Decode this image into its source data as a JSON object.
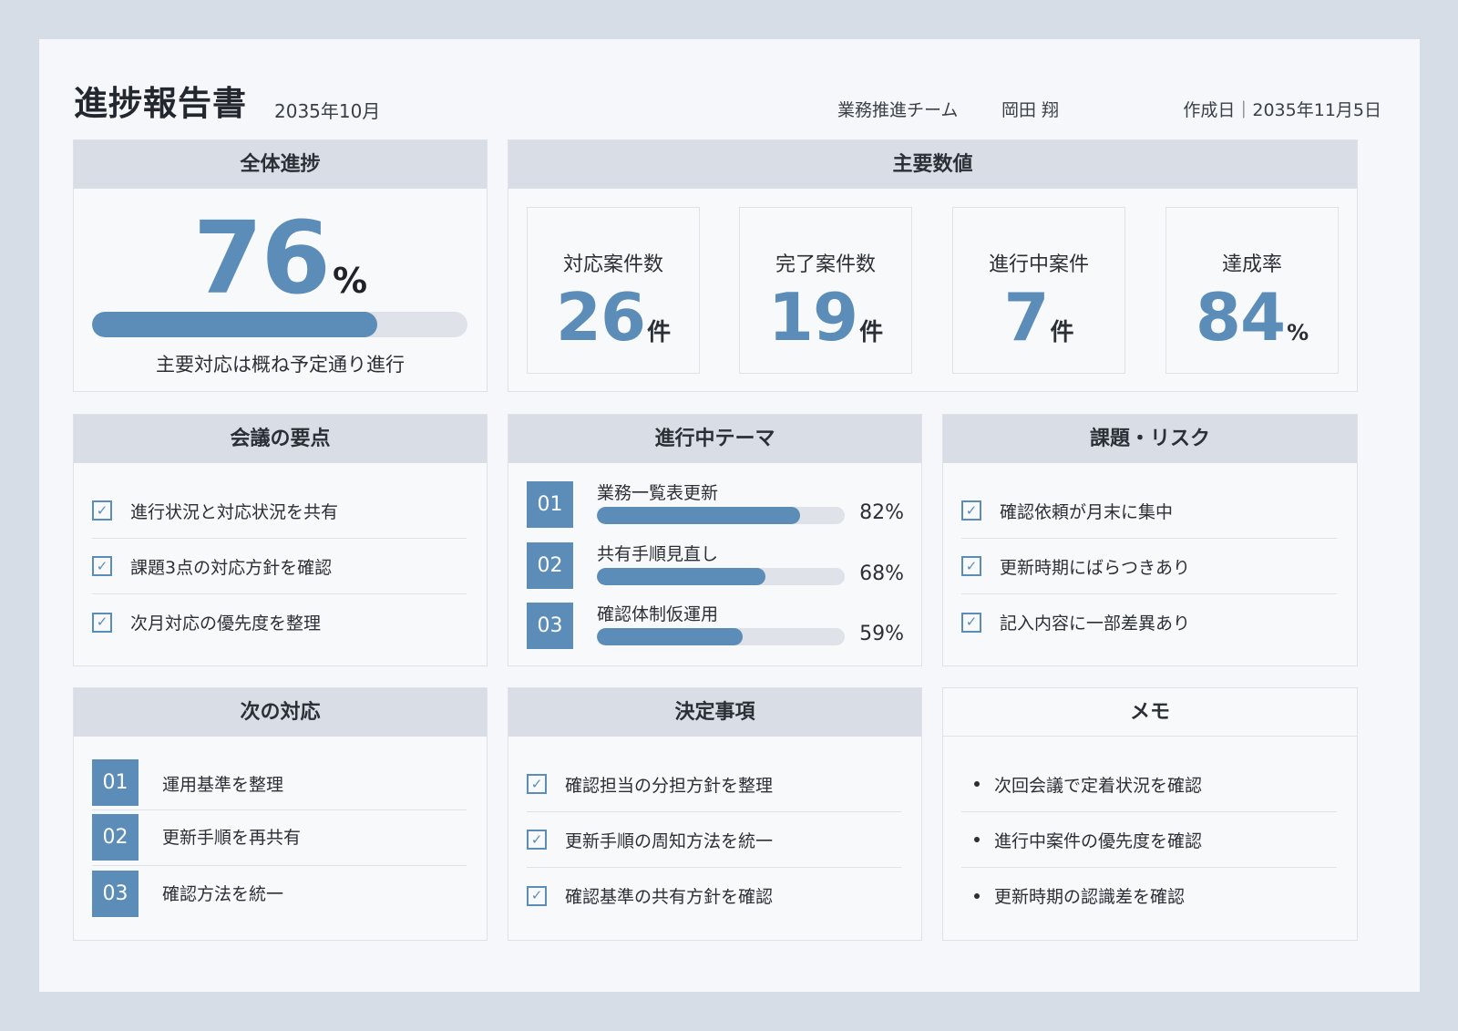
{
  "header": {
    "title": "進捗報告書",
    "period": "2035年10月",
    "team": "業務推進チーム",
    "person": "岡田 翔",
    "created": "作成日｜2035年11月5日"
  },
  "overall": {
    "heading": "全体進捗",
    "value": "76",
    "unit": "%",
    "progress": 76,
    "summary": "主要対応は概ね予定通り進行"
  },
  "metrics": {
    "heading": "主要数値",
    "items": [
      {
        "label": "対応案件数",
        "value": "26",
        "unit": "件"
      },
      {
        "label": "完了案件数",
        "value": "19",
        "unit": "件"
      },
      {
        "label": "進行中案件",
        "value": "7",
        "unit": "件"
      },
      {
        "label": "達成率",
        "value": "84",
        "unit": "%"
      }
    ]
  },
  "meeting": {
    "heading": "会議の要点",
    "items": [
      "進行状況と対応状況を共有",
      "課題3点の対応方針を確認",
      "次月対応の優先度を整理"
    ]
  },
  "themes": {
    "heading": "進行中テーマ",
    "items": [
      {
        "no": "01",
        "label": "業務一覧表更新",
        "pct_text": "82%",
        "pct": 82
      },
      {
        "no": "02",
        "label": "共有手順見直し",
        "pct_text": "68%",
        "pct": 68
      },
      {
        "no": "03",
        "label": "確認体制仮運用",
        "pct_text": "59%",
        "pct": 59
      }
    ]
  },
  "risks": {
    "heading": "課題・リスク",
    "items": [
      "確認依頼が月末に集中",
      "更新時期にばらつきあり",
      "記入内容に一部差異あり"
    ]
  },
  "next_actions": {
    "heading": "次の対応",
    "items": [
      {
        "no": "01",
        "label": "運用基準を整理"
      },
      {
        "no": "02",
        "label": "更新手順を再共有"
      },
      {
        "no": "03",
        "label": "確認方法を統一"
      }
    ]
  },
  "decisions": {
    "heading": "決定事項",
    "items": [
      "確認担当の分担方針を整理",
      "更新手順の周知方法を統一",
      "確認基準の共有方針を確認"
    ]
  },
  "memo": {
    "heading": "メモ",
    "items": [
      "次回会議で定着状況を確認",
      "進行中案件の優先度を確認",
      "更新時期の認識差を確認"
    ]
  },
  "colors": {
    "accent": "#5b8db8",
    "panel_header": "#d9dee6",
    "background": "#d7dde6"
  },
  "icons": {
    "check": "checkbox-checked-icon",
    "bullet": "bullet-dot"
  }
}
